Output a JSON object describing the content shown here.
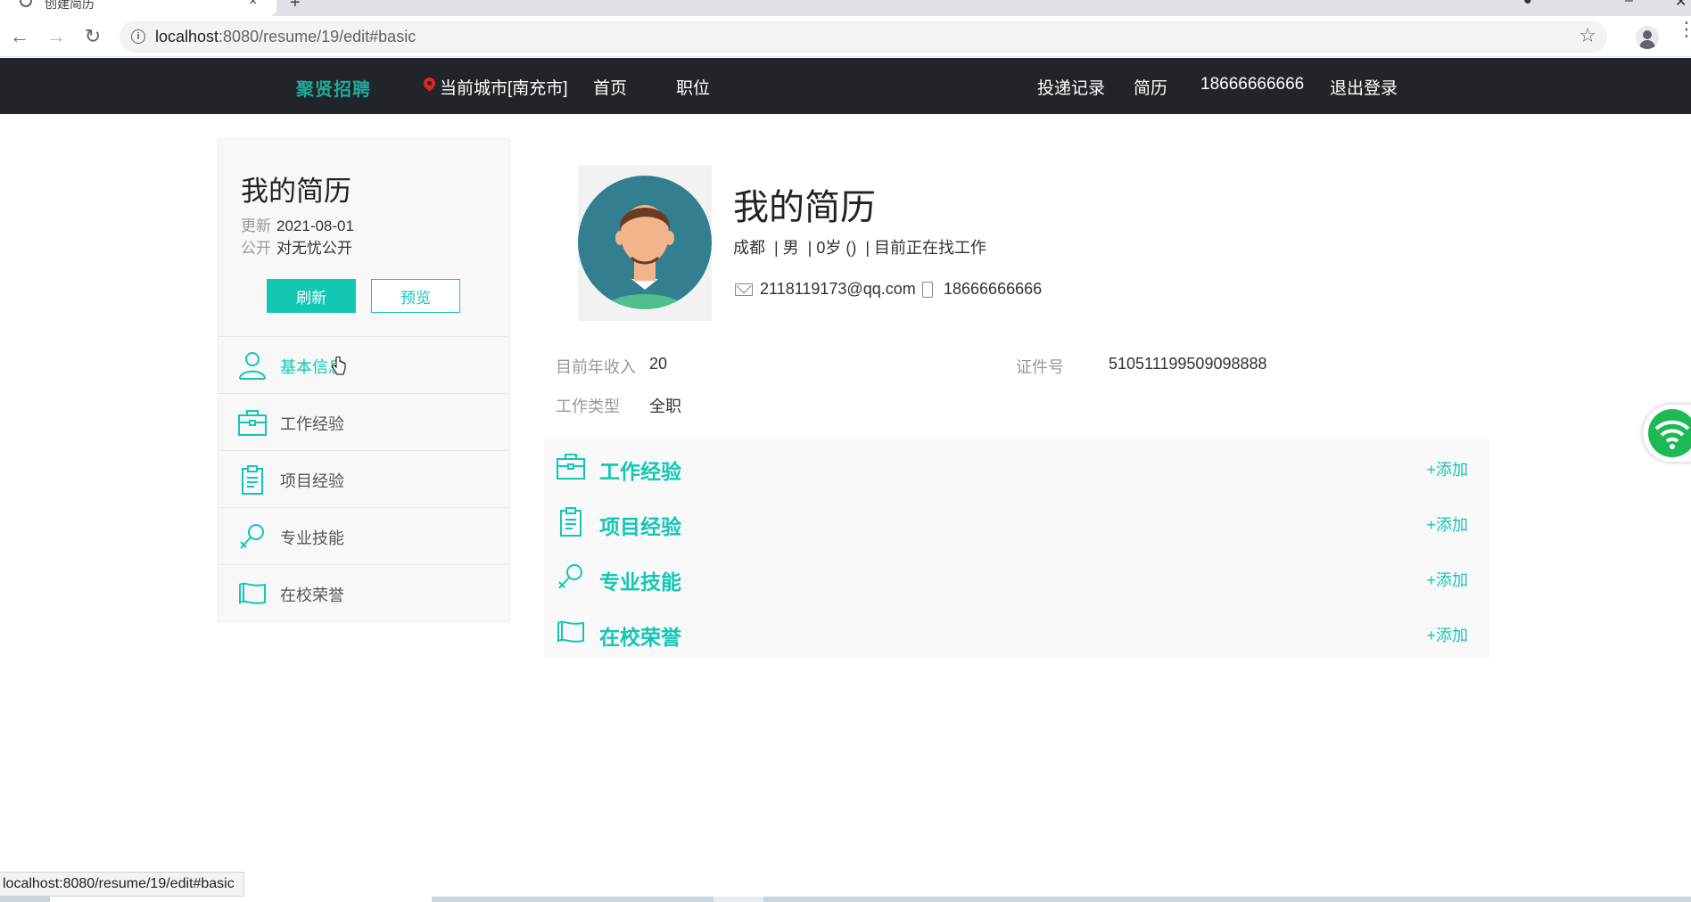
{
  "browser": {
    "tab_title": "创建简历",
    "tab_close": "×",
    "new_tab": "+",
    "url_host": "localhost",
    "url_rest": ":8080/resume/19/edit#basic",
    "status_url": "localhost:8080/resume/19/edit#basic"
  },
  "navbar": {
    "logo": "聚贤招聘",
    "city": "当前城市[南充市]",
    "home": "首页",
    "jobs": "职位",
    "records": "投递记录",
    "resume": "简历",
    "phone": "18666666666",
    "logout": "退出登录"
  },
  "sidebar": {
    "title": "我的简历",
    "update_label": "更新",
    "update_value": "2021-08-01",
    "public_label": "公开",
    "public_value": "对无忧公开",
    "refresh": "刷新",
    "preview": "预览",
    "items": [
      {
        "label": "基本信息",
        "icon": "user-icon"
      },
      {
        "label": "工作经验",
        "icon": "briefcase-icon"
      },
      {
        "label": "项目经验",
        "icon": "clipboard-icon"
      },
      {
        "label": "专业技能",
        "icon": "magnifier-icon"
      },
      {
        "label": "在校荣誉",
        "icon": "scroll-icon"
      }
    ]
  },
  "resume": {
    "title": "我的简历",
    "subtitle": "成都  | 男  | 0岁 ()  | 目前正在找工作",
    "email": "2118119173@qq.com",
    "phone": "18666666666",
    "income_label": "目前年收入",
    "income_value": "20",
    "id_label": "证件号",
    "id_value": "510511199509098888",
    "worktype_label": "工作类型",
    "worktype_value": "全职"
  },
  "sections": [
    {
      "name": "工作经验",
      "add": "+添加"
    },
    {
      "name": "项目经验",
      "add": "+添加"
    },
    {
      "name": "专业技能",
      "add": "+添加"
    },
    {
      "name": "在校荣誉",
      "add": "+添加"
    }
  ],
  "colors": {
    "accent": "#13c7b4",
    "navbar": "#212529",
    "pin": "#e0242c"
  }
}
